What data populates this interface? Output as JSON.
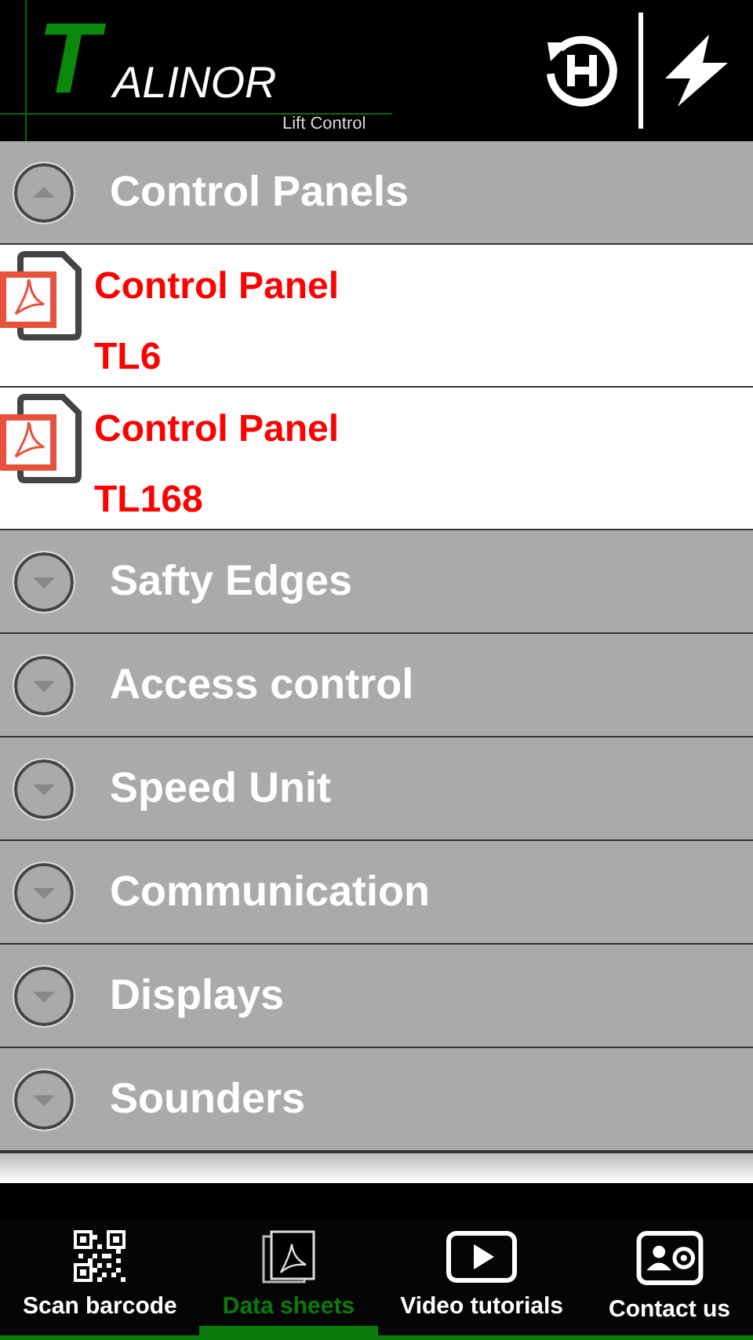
{
  "header": {
    "logo": {
      "initial": "T",
      "rest": "ALINOR",
      "tagline": "Lift Control"
    },
    "actions": [
      {
        "kind": "history"
      },
      {
        "kind": "flash"
      }
    ]
  },
  "sections": [
    {
      "title": "Control Panels",
      "expanded": true,
      "items": [
        {
          "title": "Control Panel",
          "subtitle": "TL6"
        },
        {
          "title": "Control Panel",
          "subtitle": "TL168"
        }
      ]
    },
    {
      "title": "Safty Edges",
      "expanded": false
    },
    {
      "title": "Access control",
      "expanded": false
    },
    {
      "title": "Speed Unit",
      "expanded": false
    },
    {
      "title": "Communication",
      "expanded": false
    },
    {
      "title": "Displays",
      "expanded": false
    },
    {
      "title": "Sounders",
      "expanded": false
    }
  ],
  "bottom_nav": [
    {
      "label": "Scan barcode",
      "kind": "qr",
      "selected": false
    },
    {
      "label": "Data sheets",
      "kind": "pdf",
      "selected": true
    },
    {
      "label": "Video tutorials",
      "kind": "video",
      "selected": false
    },
    {
      "label": "Contact us",
      "kind": "contact",
      "selected": false
    }
  ]
}
